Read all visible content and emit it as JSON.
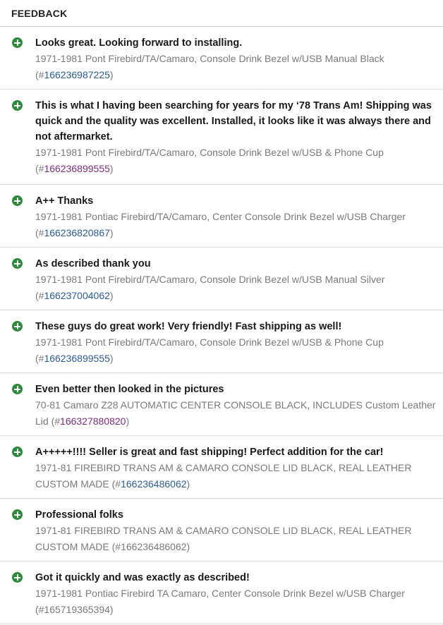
{
  "header": {
    "title": "FEEDBACK"
  },
  "items": [
    {
      "comment": "Looks great. Looking forward to installing.",
      "product": "1971-1981 Pont Firebird/TA/Camaro, Console Drink Bezel w/USB Manual Black",
      "pre": "(#",
      "id": "166236987225",
      "post": ")",
      "visited": false
    },
    {
      "comment": "This is what I having been searching for years for my ‘78 Trans Am! Shipping was quick and the quality was excellent. Installed, it looks like it was always there and not aftermarket.",
      "product": "1971-1981 Pont Firebird/TA/Camaro, Console Drink Bezel w/USB & Phone Cup",
      "pre": "(#",
      "id": "166236899555",
      "post": ")",
      "visited": true
    },
    {
      "comment": "A++ Thanks",
      "product": "1971-1981 Pontiac Firebird/TA/Camaro, Center Console Drink Bezel w/USB Charger",
      "pre": "(#",
      "id": "166236820867",
      "post": ")",
      "visited": false
    },
    {
      "comment": "As described thank you",
      "product": "1971-1981 Pont Firebird/TA/Camaro, Console Drink Bezel w/USB Manual Silver",
      "pre": "(#",
      "id": "166237004062",
      "post": ")",
      "visited": false
    },
    {
      "comment": "These guys do great work! Very friendly! Fast shipping as well!",
      "product": "1971-1981 Pont Firebird/TA/Camaro, Console Drink Bezel w/USB & Phone Cup",
      "pre": "(#",
      "id": "166236899555",
      "post": ")",
      "visited": false
    },
    {
      "comment": "Even better then looked in the pictures",
      "product": "70-81 Camaro Z28 AUTOMATIC CENTER CONSOLE BLACK, INCLUDES Custom Leather Lid",
      "pre": " (#",
      "id": "166327880820",
      "post": ")",
      "visited": true
    },
    {
      "comment": "A+++++!!!! Seller is great and fast shipping! Perfect addition for the car!",
      "product": "1971-81 FIREBIRD TRANS AM & CAMARO CONSOLE LID BLACK, REAL LEATHER CUSTOM MADE",
      "pre": " (#",
      "id": "166236486062",
      "post": ")",
      "visited": false
    },
    {
      "comment": "Professional folks",
      "product": "1971-81 FIREBIRD TRANS AM & CAMARO CONSOLE LID BLACK, REAL LEATHER CUSTOM MADE",
      "pre": " (#",
      "id": "166236486062",
      "post": ")",
      "plain": true
    },
    {
      "comment": "Got it quickly and was exactly as described!",
      "product": "1971-1981 Pontiac Firebird TA Camaro, Center Console Drink Bezel w/USB Charger",
      "pre": "(#",
      "id": "165719365394",
      "post": ")",
      "plain": true
    }
  ]
}
